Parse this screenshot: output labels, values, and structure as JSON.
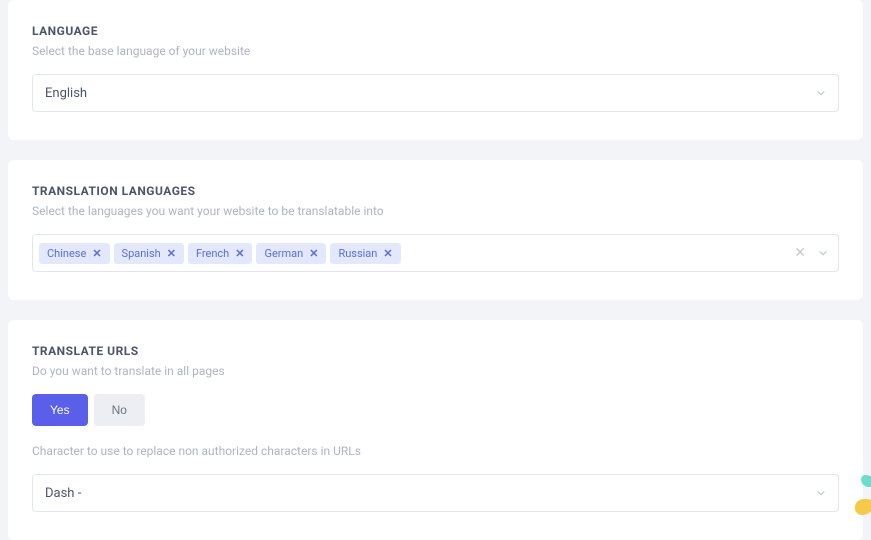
{
  "language": {
    "title": "LANGUAGE",
    "desc": "Select the base language of your website",
    "selected": "English"
  },
  "translation": {
    "title": "TRANSLATION LANGUAGES",
    "desc": "Select the languages you want your website to be translatable into",
    "tags": [
      "Chinese",
      "Spanish",
      "French",
      "German",
      "Russian"
    ]
  },
  "urls": {
    "title": "TRANSLATE URLS",
    "desc1": "Do you want to translate in all pages",
    "yes": "Yes",
    "no": "No",
    "desc2": "Character to use to replace non authorized characters in URLs",
    "selected": "Dash -"
  }
}
